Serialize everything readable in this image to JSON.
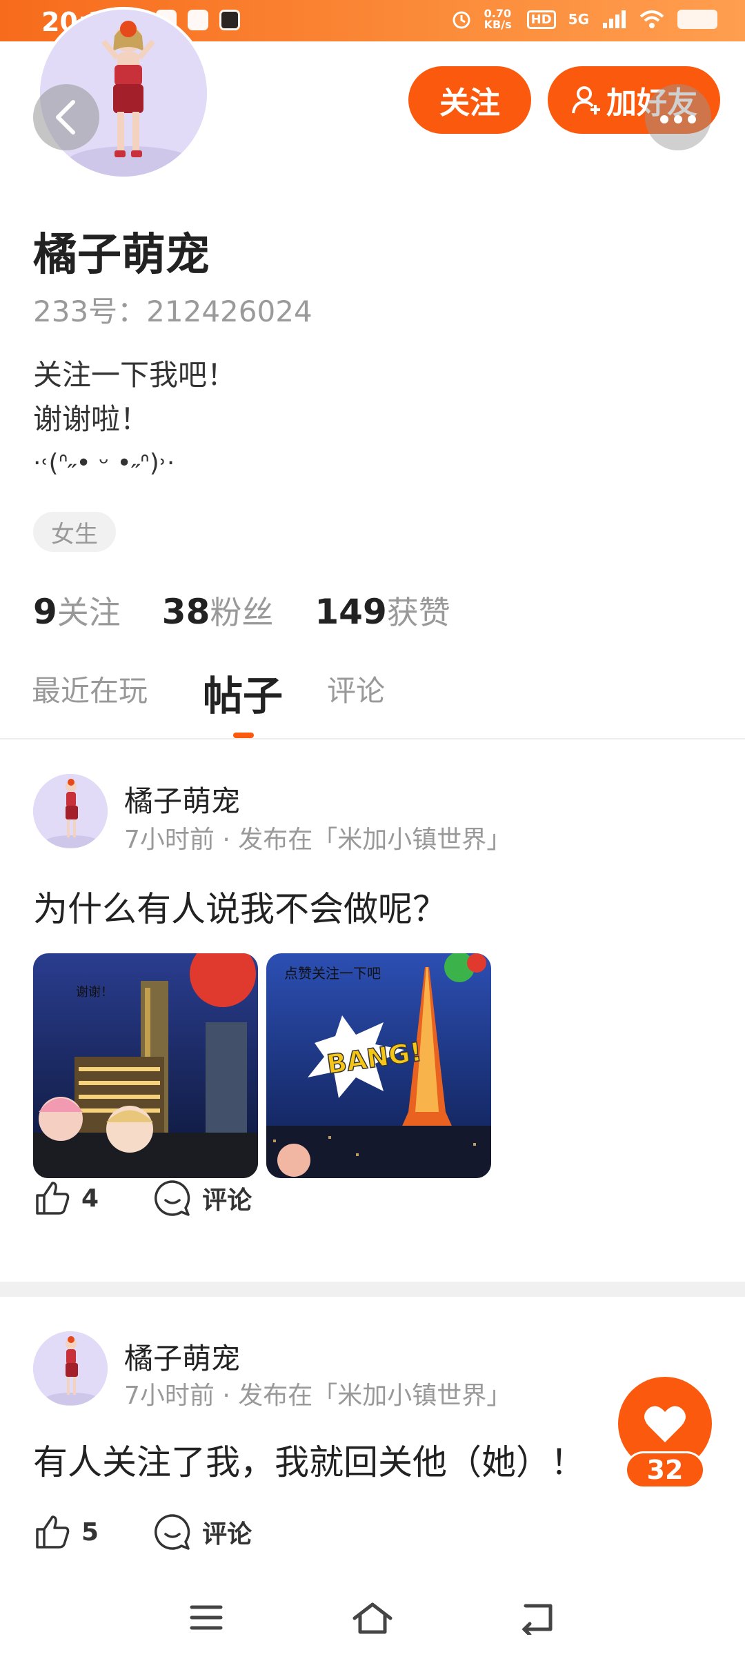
{
  "status_bar": {
    "time": "20:25",
    "network_speed": "0.70 KB/s",
    "hd": "HD",
    "signal": "5G"
  },
  "profile": {
    "name": "橘子萌宠",
    "uid": "233号：212426024",
    "bio_lines": [
      "关注一下我吧！",
      "谢谢啦！",
      "·˓(ᐢ˶• ᵕ •˶ᐢ)˒·"
    ],
    "gender": "女生",
    "follow_label": "关注",
    "add_friend_label": "加好友",
    "stats": {
      "following_count": "9",
      "following_label": "关注",
      "fans_count": "38",
      "fans_label": "粉丝",
      "likes_count": "149",
      "likes_label": "获赞"
    }
  },
  "tabs": [
    {
      "label": "最近在玩",
      "active": false
    },
    {
      "label": "帖子",
      "active": true
    },
    {
      "label": "评论",
      "active": false
    }
  ],
  "posts": [
    {
      "author": "橘子萌宠",
      "meta": "7小时前 · 发布在「米加小镇世界」",
      "text": "为什么有人说我不会做呢？",
      "images": [
        {
          "caption": "谢谢！"
        },
        {
          "caption": "点赞关注一下吧",
          "badge": "BANG!"
        }
      ],
      "likes": "4",
      "comment_label": "评论"
    },
    {
      "author": "橘子萌宠",
      "meta": "7小时前 · 发布在「米加小镇世界」",
      "text": "有人关注了我，我就回关他（她）！",
      "likes": "5",
      "comment_label": "评论"
    }
  ],
  "fab": {
    "count": "32"
  },
  "colors": {
    "accent": "#fb5a0e",
    "status_bar": "#f76b1c",
    "muted": "#999999"
  }
}
